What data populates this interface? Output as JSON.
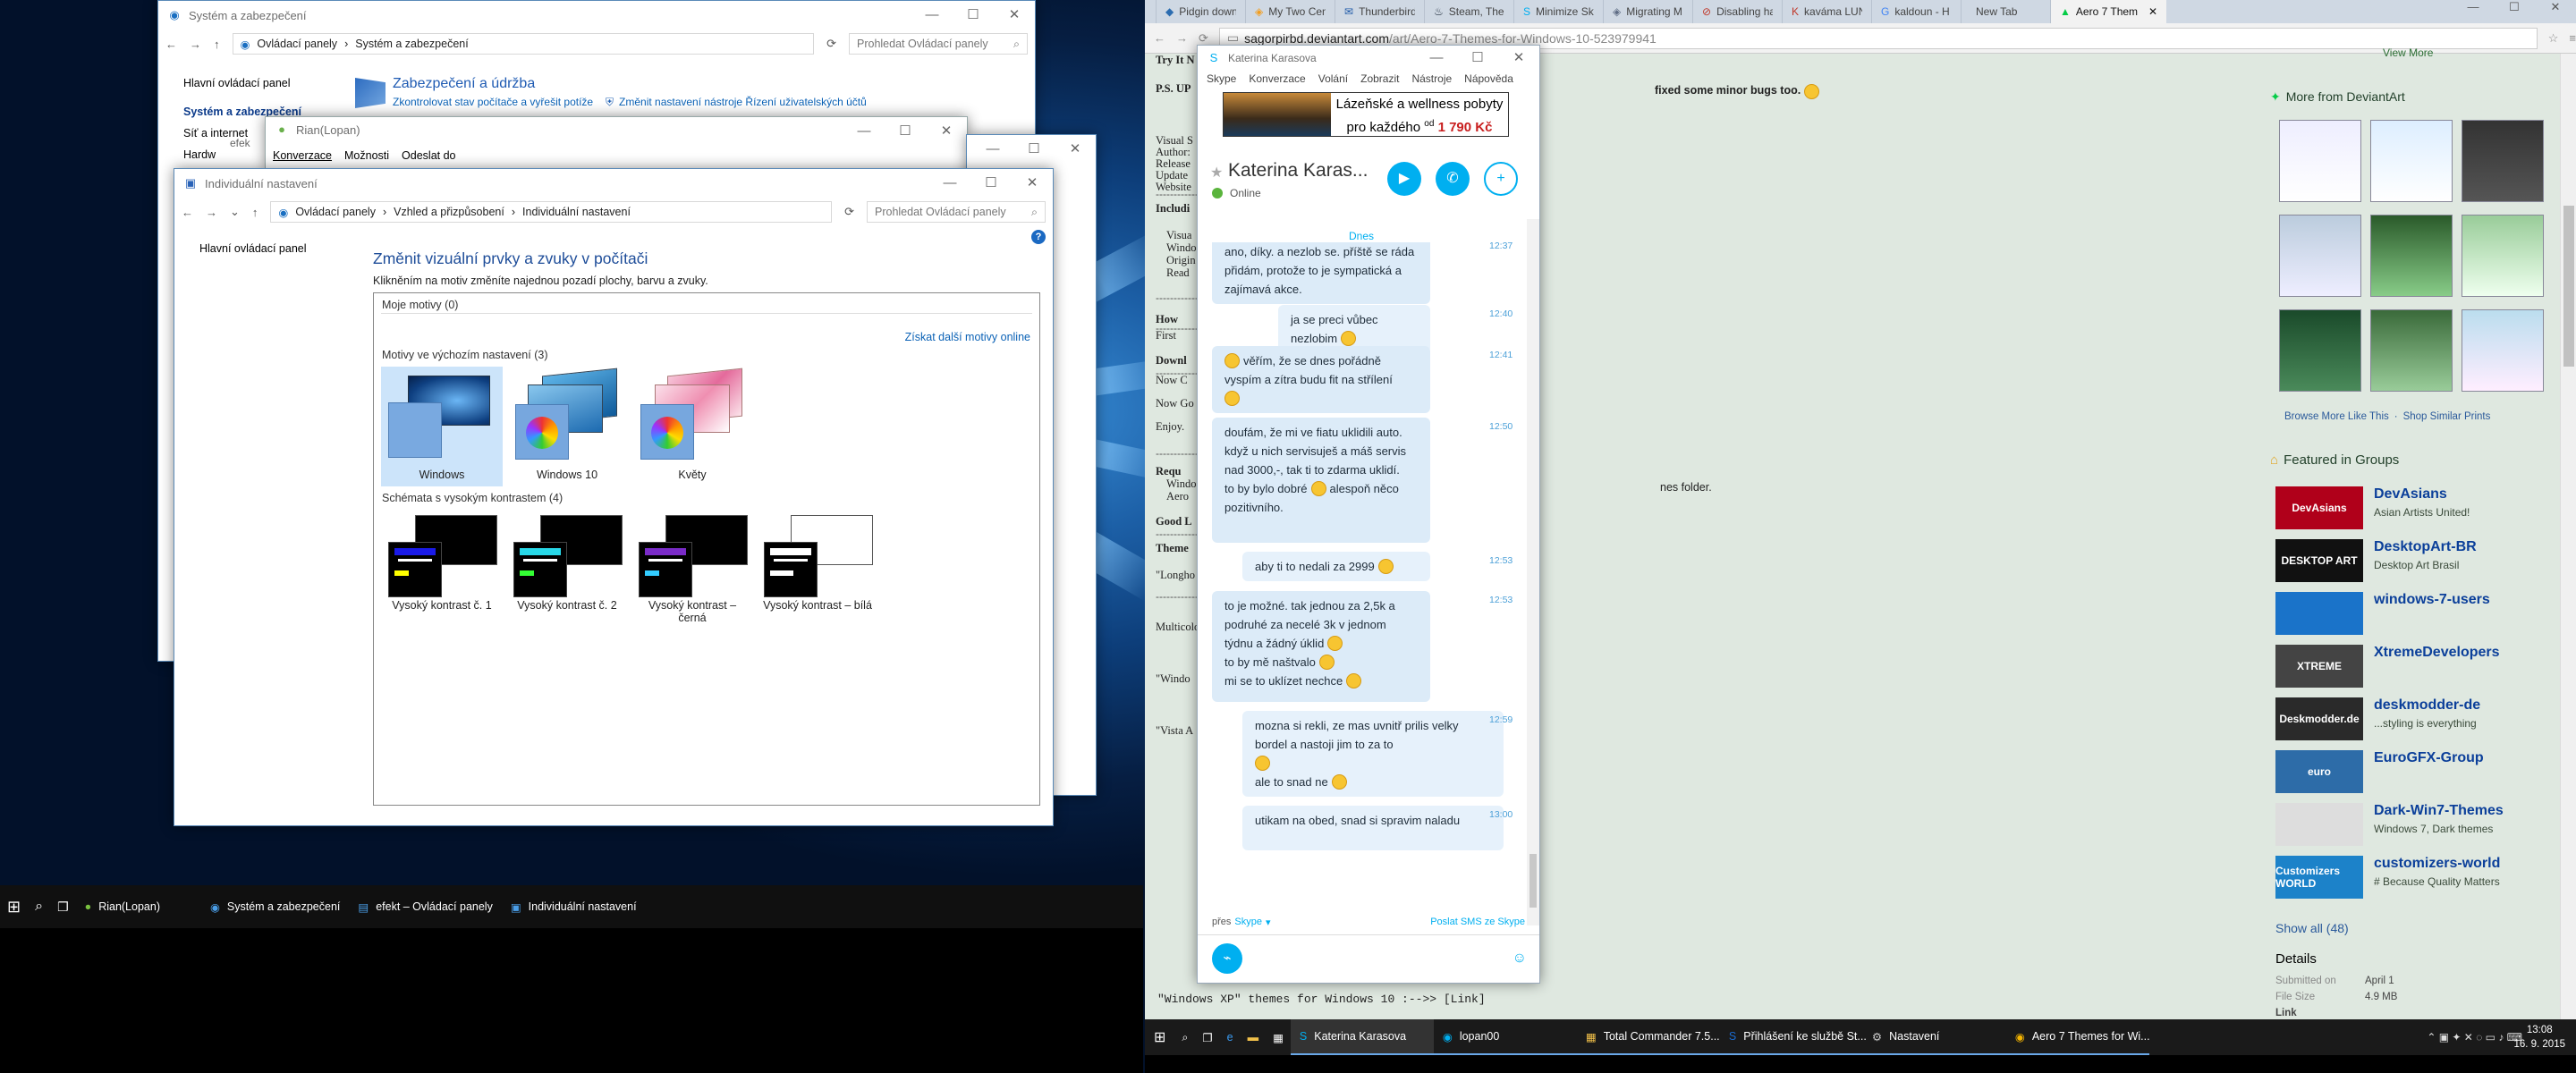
{
  "win_security": {
    "title": "Systém a zabezpečení",
    "path": [
      "Ovládací panely",
      "Systém a zabezpečení"
    ],
    "search": "Prohledat Ovládací panely",
    "nav": [
      "Hlavní ovládací panel",
      "Systém a zabezpečení",
      "Síť a internet",
      "Hardw"
    ],
    "category_title": "Zabezpečení a údržba",
    "links": [
      "Zkontrolovat stav počítače a vyřešit potíže",
      "Změnit nastavení nástroje Řízení uživatelských účtů"
    ]
  },
  "win_pidgin": {
    "title": "Rian(Lopan)",
    "menu": [
      "Konverzace",
      "Možnosti",
      "Odeslat do"
    ],
    "sub": "efek"
  },
  "win_personal": {
    "title": "Individuální nastavení",
    "path": [
      "Ovládací panely",
      "Vzhled a přizpůsobení",
      "Individuální nastavení"
    ],
    "search": "Prohledat Ovládací panely",
    "help": "?",
    "nav": "Hlavní ovládací panel",
    "heading": "Změnit vizuální prvky a zvuky v počítači",
    "subtitle": "Klikněním na motiv změníte najednou pozadí plochy, barvu a zvuky.",
    "my_themes": "Moje motivy (0)",
    "get_online": "Získat další motivy online",
    "default_group": "Motivy ve výchozím nastavení (3)",
    "themes": [
      "Windows",
      "Windows 10",
      "Květy"
    ],
    "hc_group": "Schémata s vysokým kontrastem (4)",
    "hc_themes": [
      "Vysoký kontrast č. 1",
      "Vysoký kontrast č. 2",
      "Vysoký kontrast – černá",
      "Vysoký kontrast – bílá"
    ]
  },
  "taskbar_left": {
    "items": [
      "Rian(Lopan)",
      "Systém a zabezpečení",
      "efekt – Ovládací panely",
      "Individuální nastavení"
    ]
  },
  "chrome": {
    "tabs": [
      "Pidgin down",
      "My Two Cen",
      "Thunderbird",
      "Steam, The U",
      "Minimize Sky",
      "Migrating M",
      "Disabling har",
      "kaváma LUN",
      "kaldoun - H",
      "New Tab",
      "Aero 7 Them"
    ],
    "url_host": "sagorpirbd.deviantart.com",
    "url_path": "/art/Aero-7-Themes-for-Windows-10-523979941"
  },
  "page": {
    "left_fragments": [
      "Try It N",
      "P.S. UP",
      "Visual S",
      "Author:",
      "Release",
      "Update",
      "Website",
      "Includi",
      "Visua",
      "Windo",
      "Origin",
      "Read",
      "How",
      "First",
      "Downl",
      "Now C",
      "Now Go",
      "Enjoy.",
      "Requ",
      "Windo",
      "Aero",
      "Good L",
      "Theme",
      "\"Longho",
      "Multicolo",
      "\"Windo",
      "\"Vista A",
      "\"Windows XP\" themes for Windows 10 :-->> [Link]"
    ],
    "fix_text": "fixed some minor bugs too.",
    "folder_text": "nes folder.",
    "dash": "----------------"
  },
  "sidebar": {
    "view_more": "View More",
    "more_from": "More from DeviantArt",
    "browse_more": "Browse More Like This",
    "shop": "Shop Similar Prints",
    "featured": "Featured in Groups",
    "groups": [
      {
        "name": "DevAsians",
        "sub": "Asian Artists United!",
        "logo": "DevAsians",
        "color": "#b0001a"
      },
      {
        "name": "DesktopArt-BR",
        "sub": "Desktop Art Brasil",
        "logo": "DESKTOP ART",
        "color": "#111"
      },
      {
        "name": "windows-7-users",
        "sub": "",
        "logo": "",
        "color": "#1a73c9"
      },
      {
        "name": "XtremeDevelopers",
        "sub": "",
        "logo": "XTREME",
        "color": "#444"
      },
      {
        "name": "deskmodder-de",
        "sub": "...styling is everything",
        "logo": "Deskmodder.de",
        "color": "#2a2a2a"
      },
      {
        "name": "EuroGFX-Group",
        "sub": "",
        "logo": "euro",
        "color": "#2d6ca8"
      },
      {
        "name": "Dark-Win7-Themes",
        "sub": "Windows 7, Dark themes",
        "logo": "",
        "color": "#ddd"
      },
      {
        "name": "customizers-world",
        "sub": "# Because Quality Matters",
        "logo": "Customizers WORLD",
        "color": "#1c82c9"
      }
    ],
    "show_all": "Show all (48)",
    "details": "Details",
    "submitted_label": "Submitted on",
    "submitted_val": "April 1",
    "size_label": "File Size",
    "size_val": "4.9 MB",
    "link_label": "Link"
  },
  "skype": {
    "title": "Katerina Karasova",
    "menu": [
      "Skype",
      "Konverzace",
      "Volání",
      "Zobrazit",
      "Nástroje",
      "Nápověda"
    ],
    "ad_line1": "Lázeňské a wellness pobyty",
    "ad_line2": "pro každého",
    "ad_from": "od",
    "ad_price": "1 790 Kč",
    "contact": "Katerina Karas...",
    "status": "Online",
    "day": "Dnes",
    "via_label": "přes",
    "via_value": "Skype",
    "sms": "Poslat SMS ze Skype",
    "messages": [
      {
        "text": "ano, díky. a nezlob se. příště se ráda přidám, protože to je sympatická a zajímavá akce.",
        "time": "12:37"
      },
      {
        "text": "ja se preci vůbec nezlobim",
        "time": "12:40"
      },
      {
        "text": "věřím, že se dnes pořádně vyspím a zítra budu fit na střílení",
        "time": "12:41"
      },
      {
        "text": "doufám, že mi ve fiatu uklidili auto. když u nich servisuješ a máš servis nad 3000,-, tak ti to zdarma uklidí.",
        "text2": "to by bylo dobré",
        "text2b": "alespoň něco pozitivního.",
        "time": "12:50"
      },
      {
        "text": "aby ti to nedali za 2999",
        "time": "12:53"
      },
      {
        "text": "to je možné. tak jednou za 2,5k a podruhé za necelé 3k v jednom týdnu a žádný úklid",
        "text2": "to by mě naštvalo",
        "text3": "mi se to uklízet nechce",
        "time": "12:53"
      },
      {
        "text": "mozna si rekli, ze mas uvnitř prilis velky bordel a nastoji jim to za to",
        "text2": "ale to snad ne",
        "time": "12:59"
      },
      {
        "text": "utikam na obed, snad si spravim naladu",
        "time": "13:00"
      }
    ]
  },
  "taskbar_right": {
    "items": [
      "Katerina Karasova",
      "lopan00",
      "Total Commander 7.5...",
      "Přihlášení ke službě St...",
      "Nastavení",
      "Aero 7 Themes for Wi..."
    ],
    "time": "13:08",
    "date": "16. 9. 2015"
  }
}
